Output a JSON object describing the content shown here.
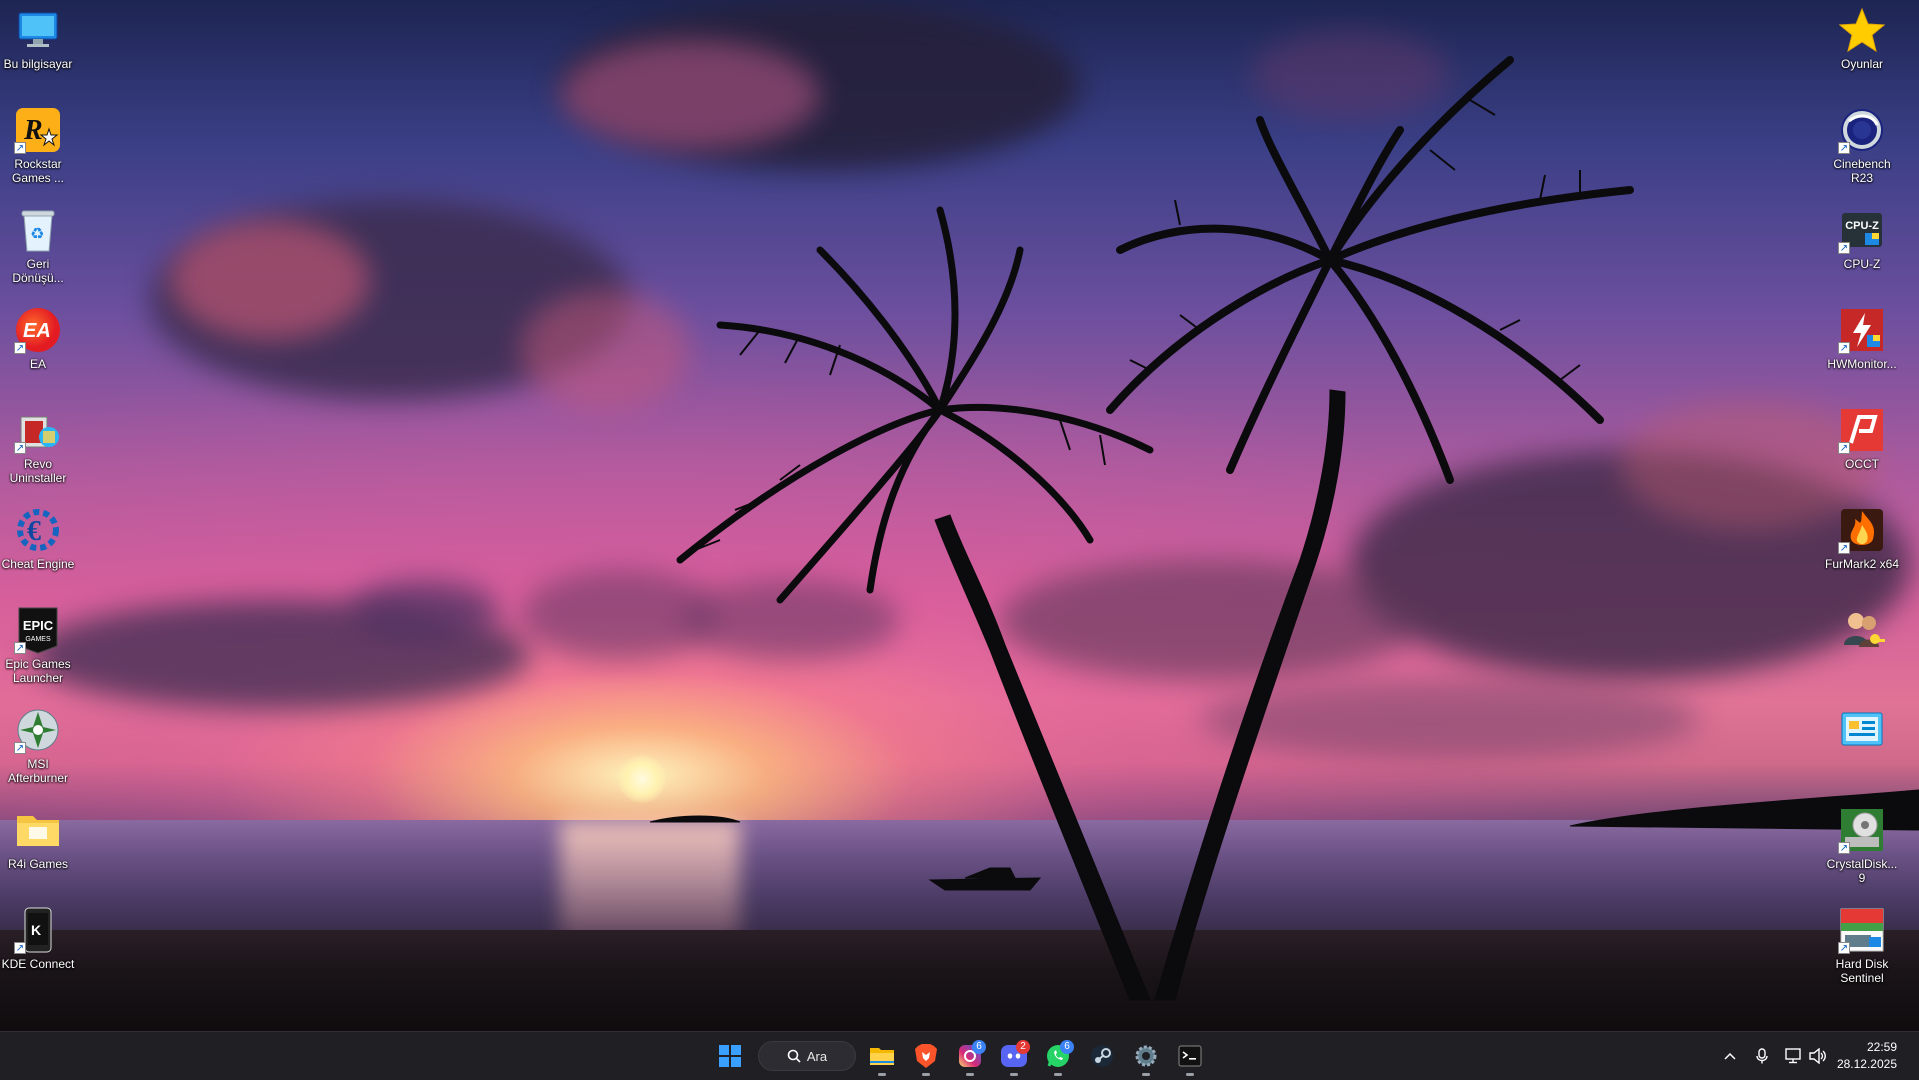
{
  "desktop": {
    "left_icons": [
      {
        "label": "Bu bilgisayar",
        "icon": "monitor-icon"
      },
      {
        "label": "Rockstar Games ...",
        "icon": "rockstar-icon"
      },
      {
        "label": "Geri Dönüşü...",
        "icon": "recycle-bin-icon"
      },
      {
        "label": "EA",
        "icon": "ea-icon"
      },
      {
        "label": "Revo Uninstaller",
        "icon": "revo-icon"
      },
      {
        "label": "Cheat Engine",
        "icon": "cheat-engine-icon"
      },
      {
        "label": "Epic Games Launcher",
        "icon": "epic-icon",
        "glyph": "EPIC"
      },
      {
        "label": "MSI Afterburner",
        "icon": "afterburner-icon"
      },
      {
        "label": "R4i Games",
        "icon": "folder-icon"
      },
      {
        "label": "KDE Connect",
        "icon": "kde-connect-icon"
      }
    ],
    "right_icons": [
      {
        "label": "Oyunlar",
        "icon": "star-icon"
      },
      {
        "label": "Cinebench R23",
        "icon": "cinebench-icon"
      },
      {
        "label": "CPU-Z",
        "icon": "cpuz-icon",
        "glyph": "CPU-Z"
      },
      {
        "label": "HWMonitor...",
        "icon": "hwmonitor-icon"
      },
      {
        "label": "OCCT",
        "icon": "occt-icon"
      },
      {
        "label": "FurMark2 x64",
        "icon": "furmark-icon"
      },
      {
        "label": "",
        "icon": "user-key-icon"
      },
      {
        "label": "",
        "icon": "control-panel-icon"
      },
      {
        "label": "CrystalDisk... 9",
        "icon": "crystaldisk-icon"
      },
      {
        "label": "Hard Disk Sentinel",
        "icon": "hdsentinel-icon"
      }
    ]
  },
  "taskbar": {
    "search_label": "Ara",
    "apps": [
      {
        "name": "start",
        "icon": "windows-icon"
      },
      {
        "name": "file-explorer",
        "icon": "folder-icon"
      },
      {
        "name": "brave",
        "icon": "brave-icon"
      },
      {
        "name": "instagram",
        "icon": "instagram-icon",
        "badge": "6"
      },
      {
        "name": "discord",
        "icon": "discord-icon",
        "badge": "2"
      },
      {
        "name": "whatsapp",
        "icon": "whatsapp-icon",
        "badge": "6"
      },
      {
        "name": "steam",
        "icon": "steam-icon"
      },
      {
        "name": "settings",
        "icon": "gear-icon"
      },
      {
        "name": "terminal",
        "icon": "terminal-icon"
      }
    ],
    "clock": {
      "time": "22:59",
      "date": "28.12.2025"
    }
  },
  "colors": {
    "taskbar_bg": "#1f1f24",
    "badge": "#3b82f6",
    "accent": "#0a84ff"
  }
}
